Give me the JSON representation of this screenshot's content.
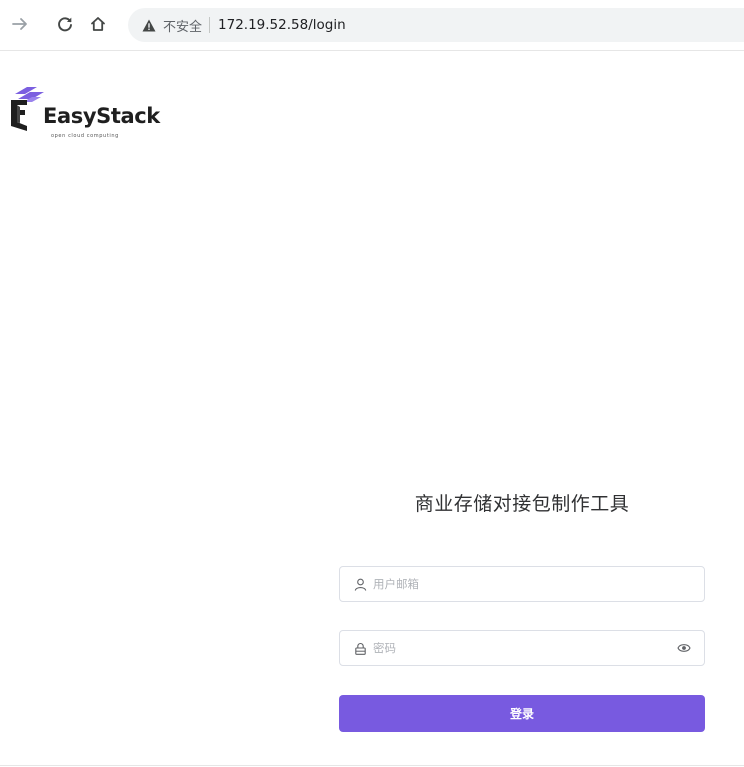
{
  "browser": {
    "security_label": "不安全",
    "url": "172.19.52.58/login"
  },
  "logo": {
    "name": "EasyStack",
    "tagline": "open cloud computing"
  },
  "login": {
    "title": "商业存储对接包制作工具",
    "username_placeholder": "用户邮箱",
    "password_placeholder": "密码",
    "submit_label": "登录"
  },
  "colors": {
    "accent": "#785ae0",
    "logo_mark": "#7b5fe0",
    "input_border": "#dcdfe6"
  }
}
